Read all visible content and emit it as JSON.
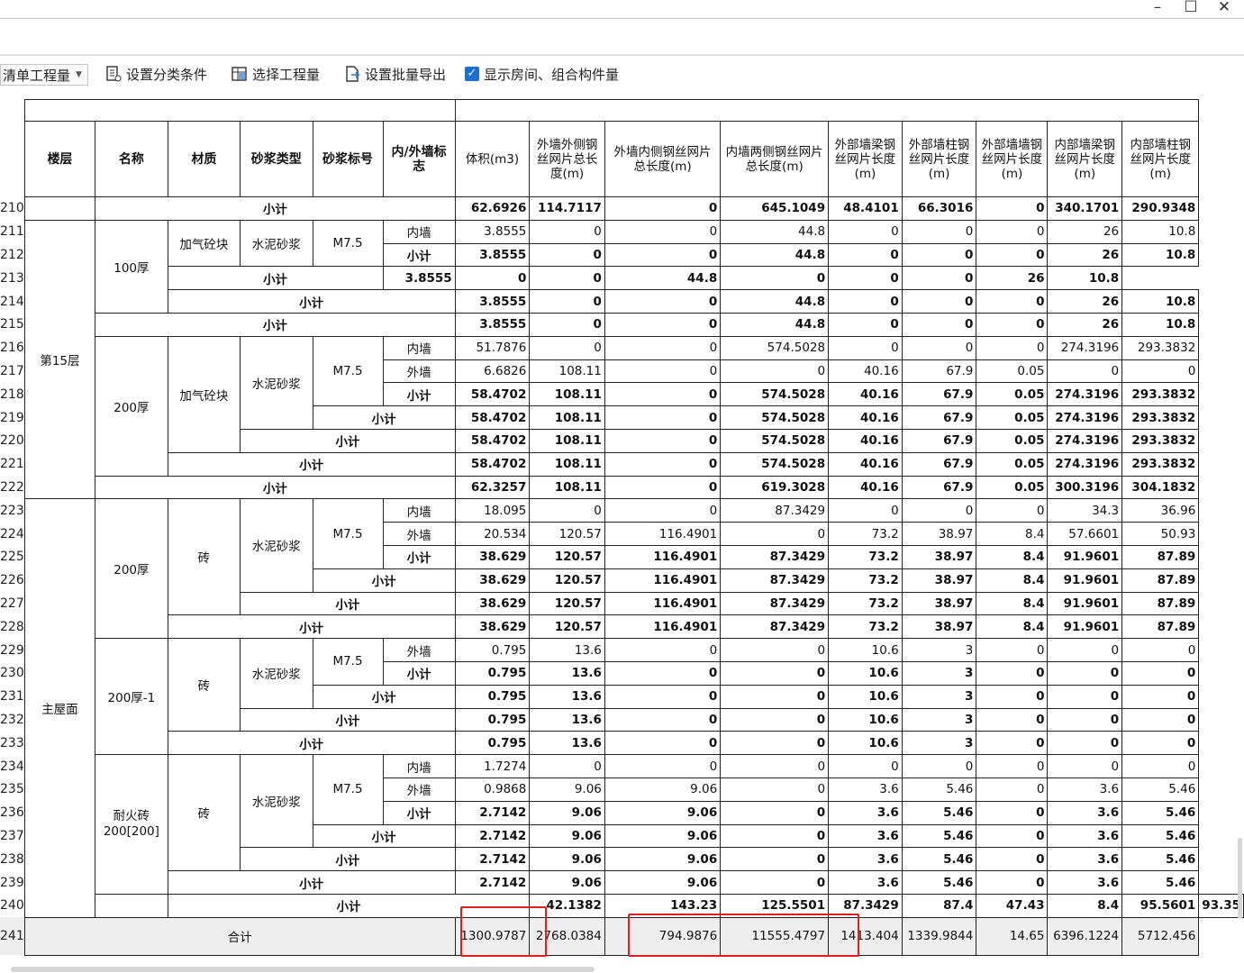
{
  "toolbar": {
    "dropdown_label": "清单工程量",
    "set_category": "设置分类条件",
    "select_quantity": "选择工程量",
    "batch_export": "设置批量导出",
    "show_rooms": "显示房间、组合构件量",
    "show_rooms_checked": true
  },
  "table": {
    "headers": [
      "楼层",
      "名称",
      "材质",
      "砂浆类型",
      "砂浆标号",
      "内/外墙标志",
      "体积(m3)",
      "外墙外侧钢丝网片总长度(m)",
      "外墙内侧钢丝网片总长度(m)",
      "内墙两侧钢丝网片总长度(m)",
      "外部墙梁钢丝网片长度(m)",
      "外部墙柱钢丝网片长度(m)",
      "外部墙墙钢丝网片长度(m)",
      "内部墙梁钢丝网片长度(m)",
      "内部墙柱钢丝网片长度(m)"
    ],
    "rows": [
      {
        "n": "210",
        "level": "subtotal",
        "values": [
          "62.6926",
          "114.7117",
          "0",
          "645.1049",
          "48.4101",
          "66.3016",
          "0",
          "340.1701",
          "290.9348"
        ]
      },
      {
        "n": "211",
        "mark": "内墙",
        "values": [
          "3.8555",
          "0",
          "0",
          "44.8",
          "0",
          "0",
          "0",
          "26",
          "10.8"
        ]
      },
      {
        "n": "212",
        "mark": "小计",
        "values": [
          "3.8555",
          "0",
          "0",
          "44.8",
          "0",
          "0",
          "0",
          "26",
          "10.8"
        ]
      },
      {
        "n": "213",
        "values": [
          "3.8555",
          "0",
          "0",
          "44.8",
          "0",
          "0",
          "0",
          "26",
          "10.8"
        ]
      },
      {
        "n": "214",
        "values": [
          "3.8555",
          "0",
          "0",
          "44.8",
          "0",
          "0",
          "0",
          "26",
          "10.8"
        ]
      },
      {
        "n": "215",
        "values": [
          "3.8555",
          "0",
          "0",
          "44.8",
          "0",
          "0",
          "0",
          "26",
          "10.8"
        ]
      },
      {
        "n": "216",
        "mark": "内墙",
        "values": [
          "51.7876",
          "0",
          "0",
          "574.5028",
          "0",
          "0",
          "0",
          "274.3196",
          "293.3832"
        ]
      },
      {
        "n": "217",
        "mark": "外墙",
        "values": [
          "6.6826",
          "108.11",
          "0",
          "0",
          "40.16",
          "67.9",
          "0.05",
          "0",
          "0"
        ]
      },
      {
        "n": "218",
        "mark": "小计",
        "values": [
          "58.4702",
          "108.11",
          "0",
          "574.5028",
          "40.16",
          "67.9",
          "0.05",
          "274.3196",
          "293.3832"
        ]
      },
      {
        "n": "219",
        "values": [
          "58.4702",
          "108.11",
          "0",
          "574.5028",
          "40.16",
          "67.9",
          "0.05",
          "274.3196",
          "293.3832"
        ]
      },
      {
        "n": "220",
        "values": [
          "58.4702",
          "108.11",
          "0",
          "574.5028",
          "40.16",
          "67.9",
          "0.05",
          "274.3196",
          "293.3832"
        ]
      },
      {
        "n": "221",
        "values": [
          "58.4702",
          "108.11",
          "0",
          "574.5028",
          "40.16",
          "67.9",
          "0.05",
          "274.3196",
          "293.3832"
        ]
      },
      {
        "n": "222",
        "values": [
          "62.3257",
          "108.11",
          "0",
          "619.3028",
          "40.16",
          "67.9",
          "0.05",
          "300.3196",
          "304.1832"
        ]
      },
      {
        "n": "223",
        "mark": "内墙",
        "values": [
          "18.095",
          "0",
          "0",
          "87.3429",
          "0",
          "0",
          "0",
          "34.3",
          "36.96"
        ]
      },
      {
        "n": "224",
        "mark": "外墙",
        "values": [
          "20.534",
          "120.57",
          "116.4901",
          "0",
          "73.2",
          "38.97",
          "8.4",
          "57.6601",
          "50.93"
        ]
      },
      {
        "n": "225",
        "mark": "小计",
        "values": [
          "38.629",
          "120.57",
          "116.4901",
          "87.3429",
          "73.2",
          "38.97",
          "8.4",
          "91.9601",
          "87.89"
        ]
      },
      {
        "n": "226",
        "values": [
          "38.629",
          "120.57",
          "116.4901",
          "87.3429",
          "73.2",
          "38.97",
          "8.4",
          "91.9601",
          "87.89"
        ]
      },
      {
        "n": "227",
        "values": [
          "38.629",
          "120.57",
          "116.4901",
          "87.3429",
          "73.2",
          "38.97",
          "8.4",
          "91.9601",
          "87.89"
        ]
      },
      {
        "n": "228",
        "values": [
          "38.629",
          "120.57",
          "116.4901",
          "87.3429",
          "73.2",
          "38.97",
          "8.4",
          "91.9601",
          "87.89"
        ]
      },
      {
        "n": "229",
        "mark": "外墙",
        "values": [
          "0.795",
          "13.6",
          "0",
          "0",
          "10.6",
          "3",
          "0",
          "0",
          "0"
        ]
      },
      {
        "n": "230",
        "mark": "小计",
        "values": [
          "0.795",
          "13.6",
          "0",
          "0",
          "10.6",
          "3",
          "0",
          "0",
          "0"
        ]
      },
      {
        "n": "231",
        "values": [
          "0.795",
          "13.6",
          "0",
          "0",
          "10.6",
          "3",
          "0",
          "0",
          "0"
        ]
      },
      {
        "n": "232",
        "values": [
          "0.795",
          "13.6",
          "0",
          "0",
          "10.6",
          "3",
          "0",
          "0",
          "0"
        ]
      },
      {
        "n": "233",
        "values": [
          "0.795",
          "13.6",
          "0",
          "0",
          "10.6",
          "3",
          "0",
          "0",
          "0"
        ]
      },
      {
        "n": "234",
        "mark": "内墙",
        "values": [
          "1.7274",
          "0",
          "0",
          "0",
          "0",
          "0",
          "0",
          "0",
          "0"
        ]
      },
      {
        "n": "235",
        "mark": "外墙",
        "values": [
          "0.9868",
          "9.06",
          "9.06",
          "0",
          "3.6",
          "5.46",
          "0",
          "3.6",
          "5.46"
        ]
      },
      {
        "n": "236",
        "mark": "小计",
        "values": [
          "2.7142",
          "9.06",
          "9.06",
          "0",
          "3.6",
          "5.46",
          "0",
          "3.6",
          "5.46"
        ]
      },
      {
        "n": "237",
        "values": [
          "2.7142",
          "9.06",
          "9.06",
          "0",
          "3.6",
          "5.46",
          "0",
          "3.6",
          "5.46"
        ]
      },
      {
        "n": "238",
        "values": [
          "2.7142",
          "9.06",
          "9.06",
          "0",
          "3.6",
          "5.46",
          "0",
          "3.6",
          "5.46"
        ]
      },
      {
        "n": "239",
        "values": [
          "2.7142",
          "9.06",
          "9.06",
          "0",
          "3.6",
          "5.46",
          "0",
          "3.6",
          "5.46"
        ]
      },
      {
        "n": "240",
        "values": [
          "42.1382",
          "143.23",
          "125.5501",
          "87.3429",
          "87.4",
          "47.43",
          "8.4",
          "95.5601",
          "93.35"
        ]
      },
      {
        "n": "241",
        "values": [
          "1300.9787",
          "2768.0384",
          "794.9876",
          "11555.4797",
          "1413.404",
          "1339.9844",
          "14.65",
          "6396.1224",
          "5712.456"
        ]
      }
    ],
    "labels": {
      "subtotal": "小计",
      "total": "合计",
      "floor15": "第15层",
      "main_roof": "主屋面",
      "name_100": "100厚",
      "name_200": "200厚",
      "name_200b": "200厚",
      "name_200_1": "200厚-1",
      "name_fire": "耐火砖200[200]",
      "mat_aerated": "加气砼块",
      "mat_aerated2": "加气砼块",
      "mat_brick": "砖",
      "mortar_type": "水泥砂浆",
      "mortar_grade": "M7.5"
    },
    "highlight_color": "#e0201a"
  }
}
